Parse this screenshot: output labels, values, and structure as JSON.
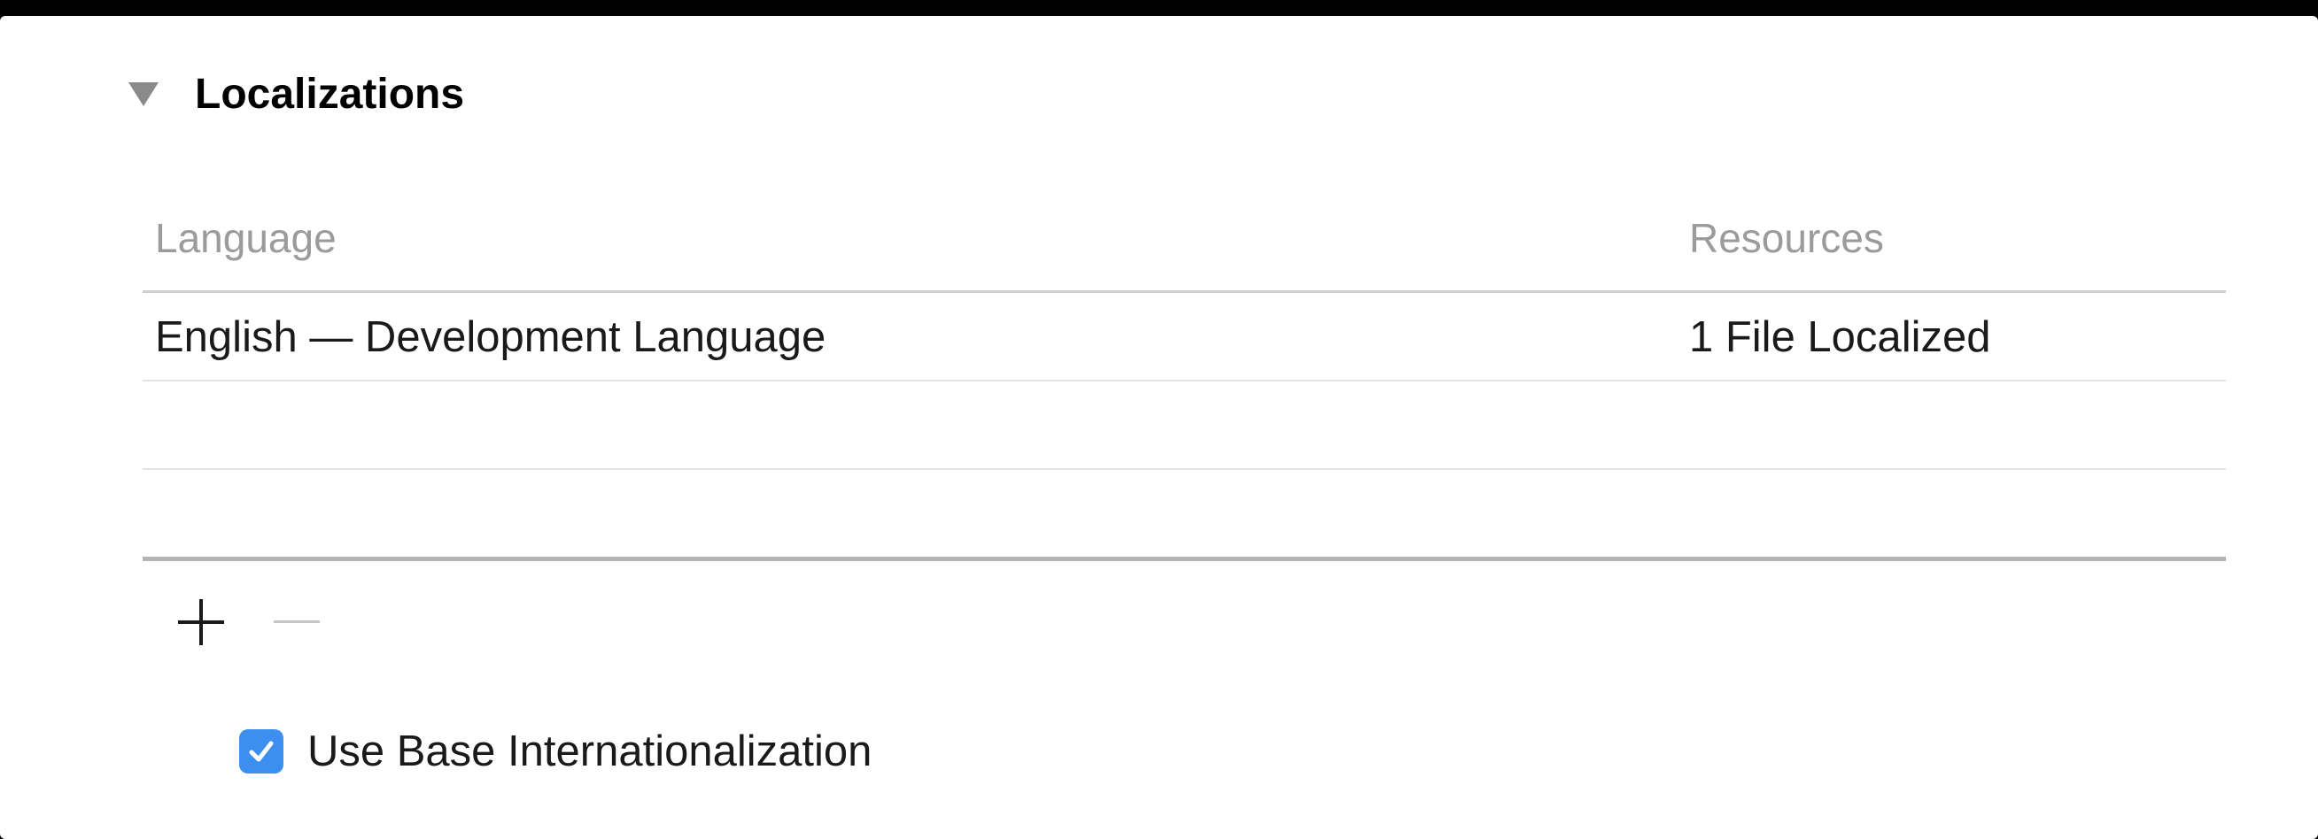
{
  "section": {
    "title": "Localizations",
    "expanded": true
  },
  "table": {
    "columns": {
      "language": "Language",
      "resources": "Resources"
    },
    "rows": [
      {
        "language": "English — Development Language",
        "resources": "1 File Localized"
      },
      {
        "language": "",
        "resources": ""
      },
      {
        "language": "",
        "resources": ""
      }
    ]
  },
  "controls": {
    "add_icon": "plus-icon",
    "remove_icon": "minus-icon",
    "remove_enabled": false
  },
  "base_internationalization": {
    "label": "Use Base Internationalization",
    "checked": true
  },
  "colors": {
    "checkbox_accent": "#3d8fef",
    "header_text": "#9b9b9b",
    "background": "#ffffff"
  }
}
